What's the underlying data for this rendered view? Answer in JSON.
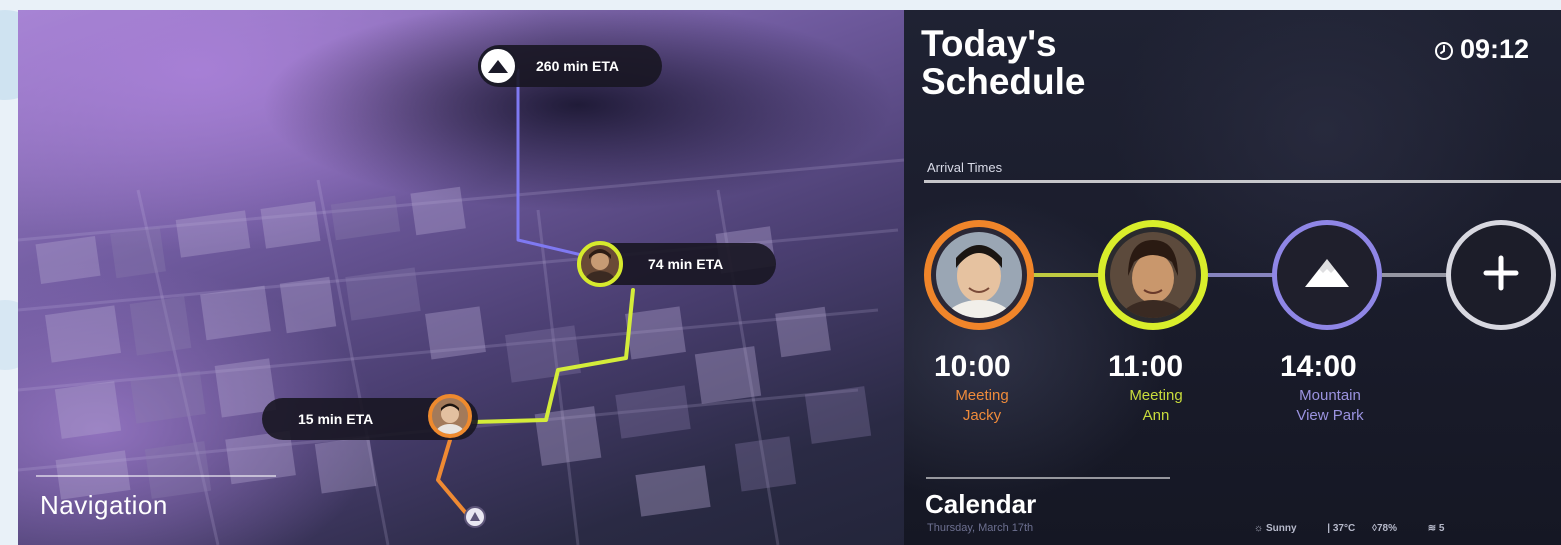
{
  "map": {
    "title": "Navigation",
    "etas": [
      {
        "label": "260 min ETA",
        "destination": "mountain"
      },
      {
        "label": "74 min ETA",
        "destination": "ann"
      },
      {
        "label": "15 min ETA",
        "destination": "jacky"
      }
    ],
    "route_colors": {
      "mountain": "#7f79f2",
      "ann": "#d4ec3a",
      "jacky": "#ef8a33"
    }
  },
  "schedule": {
    "title": "Today's Schedule",
    "clock": "09:12",
    "section_label": "Arrival Times",
    "events": [
      {
        "time": "10:00",
        "label_line1": "Meeting",
        "label_line2": "Jacky",
        "ring_color": "#f0852a"
      },
      {
        "time": "11:00",
        "label_line1": "Meeting",
        "label_line2": "Ann",
        "ring_color": "#d9ee2b"
      },
      {
        "time": "14:00",
        "label_line1": "Mountain",
        "label_line2": "View Park",
        "ring_color": "#8f86e6"
      }
    ],
    "add_icon": "plus-icon"
  },
  "calendar": {
    "title": "Calendar",
    "date": "Thursday, March 17th"
  },
  "weather": {
    "condition": "Sunny",
    "temperature": "| 37°C",
    "humidity": "78%",
    "wind": "5"
  }
}
